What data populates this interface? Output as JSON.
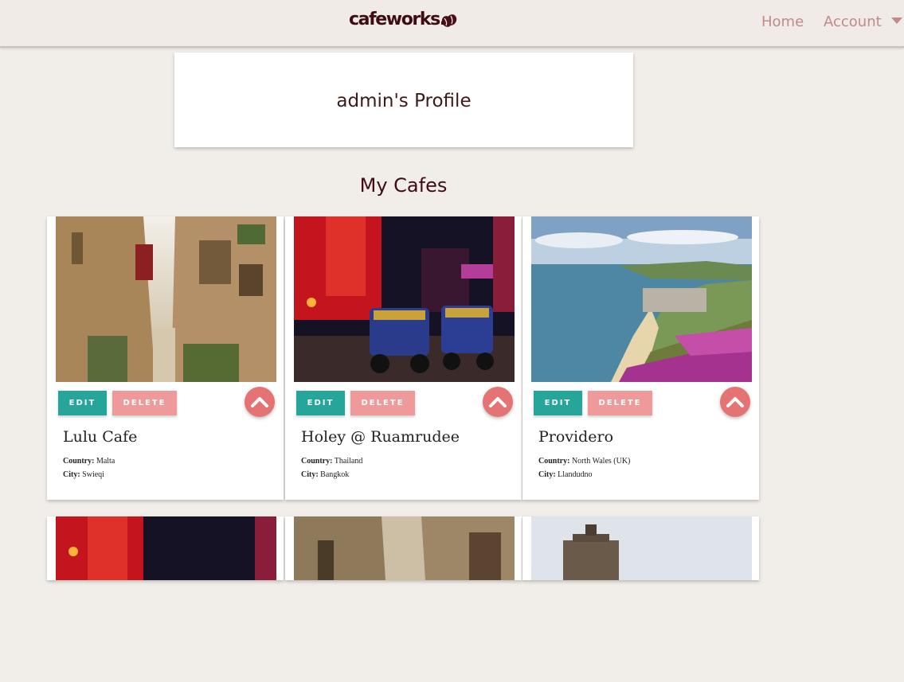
{
  "nav": {
    "brand": "cafeworks.",
    "links": {
      "home": "Home",
      "account": "Account"
    }
  },
  "profile": {
    "title": "admin's Profile"
  },
  "section": {
    "title": "My Cafes"
  },
  "labels": {
    "edit": "EDIT",
    "delete": "DELETE",
    "country": "Country:",
    "city": "City:"
  },
  "cafes": [
    {
      "name": "Lulu Cafe",
      "country": "Malta",
      "city": "Swieqi",
      "image": "narrow-stone-alley"
    },
    {
      "name": "Holey @ Ruamrudee",
      "country": "Thailand",
      "city": "Bangkok",
      "image": "neon-street-tuktuks"
    },
    {
      "name": "Providero",
      "country": "North Wales (UK)",
      "city": "Llandudno",
      "image": "coastal-bay-view"
    }
  ],
  "colors": {
    "accent_edit": "#26a69a",
    "accent_delete": "#ee9a9a",
    "fab": "#e57373",
    "brand": "#3e0c12",
    "nav_link": "#c08a86",
    "background": "#f1ede8"
  }
}
